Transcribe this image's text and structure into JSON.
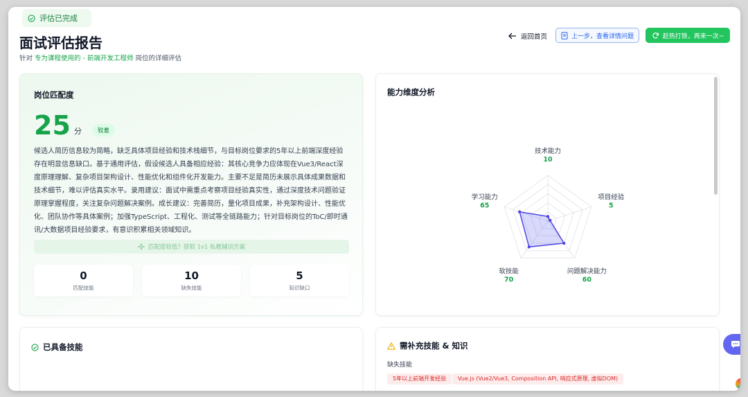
{
  "header": {
    "status": "评估已完成",
    "title": "面试评估报告",
    "subtitle_prefix": "针对",
    "subtitle_role": "专为课程使用的 - 前端开发工程师",
    "subtitle_suffix": "岗位的详细评估",
    "back_label": "返回首页",
    "prev_label": "上一步，查看详情问题",
    "retry_label": "趁热打铁，再来一次~"
  },
  "match": {
    "title": "岗位匹配度",
    "score": "25",
    "unit": "分",
    "level": "较差",
    "summary": "候选人简历信息较为简略，缺乏具体项目经验和技术栈细节，与目标岗位要求的5年以上前端深度经验存在明显信息缺口。基于通用评估，假设候选人具备相应经验：其核心竞争力应体现在Vue3/React深度原理理解、复杂项目架构设计、性能优化和组件化开发能力。主要不足是简历未展示具体成果数据和技术细节，难以评估真实水平。录用建议：面试中需重点考察项目经验真实性，通过深度技术问题验证原理掌握程度，关注复杂问题解决案例。成长建议：完善简历，量化项目成果，补充架构设计、性能优化、团队协作等具体案例；加强TypeScript、工程化、测试等全链路能力；针对目标岗位的ToC/即时通讯/大数据项目经验要求，有意识积累相关领域知识。",
    "upsell": "匹配度较低？获取 1v1 私教辅训方案",
    "stats": [
      {
        "value": "0",
        "label": "匹配技能"
      },
      {
        "value": "10",
        "label": "缺失技能"
      },
      {
        "value": "5",
        "label": "知识缺口"
      }
    ]
  },
  "radar": {
    "title": "能力维度分析",
    "max": 100,
    "axes": [
      {
        "name": "技术能力",
        "value": 10
      },
      {
        "name": "项目经验",
        "value": 5
      },
      {
        "name": "问题解决能力",
        "value": 60
      },
      {
        "name": "软技能",
        "value": 70
      },
      {
        "name": "学习能力",
        "value": 65
      }
    ]
  },
  "skills": {
    "title": "已具备技能"
  },
  "gaps": {
    "title": "需补充技能 & 知识",
    "subtitle": "缺失技能",
    "tags": [
      "5年以上前端开发经验",
      "Vue.js (Vue2/Vue3, Composition API, 响应式原理, 虚拟DOM)"
    ]
  },
  "colors": {
    "accent_green": "#16a34a",
    "radar_fill": "#6366f1",
    "gap_tag_bg": "#fdecec"
  },
  "icons": [
    "check-circle-icon",
    "arrow-left-icon",
    "document-icon",
    "refresh-icon",
    "sparkle-icon",
    "warning-icon",
    "chat-icon"
  ]
}
